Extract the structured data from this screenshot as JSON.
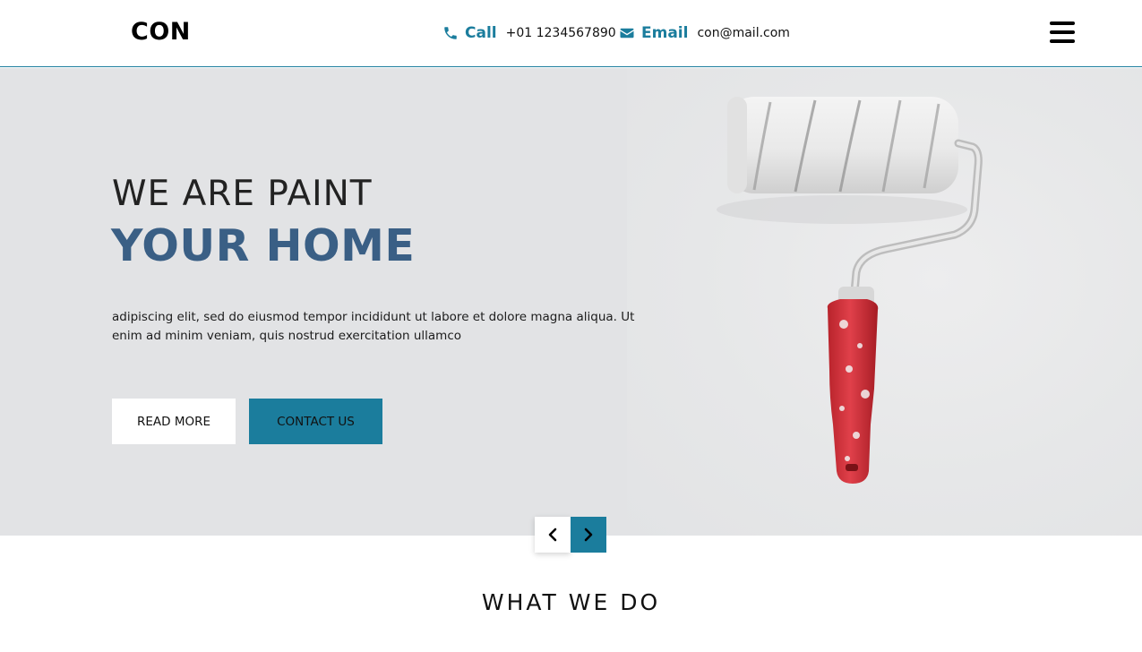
{
  "header": {
    "logo": "CON",
    "call_label": "Call",
    "call_value": "+01 1234567890",
    "email_label": "Email",
    "email_value": "con@mail.com",
    "icons": {
      "call": "phone-icon",
      "email": "envelope-icon",
      "menu": "hamburger-menu-icon"
    }
  },
  "hero": {
    "title_line1": "WE ARE PAINT",
    "title_line2": "YOUR HOME",
    "text": "adipiscing elit, sed do eiusmod tempor incididunt ut labore et dolore magna aliqua. Ut enim ad minim veniam, quis nostrud exercitation ullamco",
    "read_more_label": "READ MORE",
    "contact_label": "CONTACT US"
  },
  "slider": {
    "prev_icon": "chevron-left-icon",
    "next_icon": "chevron-right-icon"
  },
  "section": {
    "title": "WHAT WE DO"
  },
  "colors": {
    "accent": "#1b7d9d",
    "title_blue": "#3a5f85",
    "hero_bg": "#e2e3e5",
    "roller_handle": "#d9333c"
  }
}
